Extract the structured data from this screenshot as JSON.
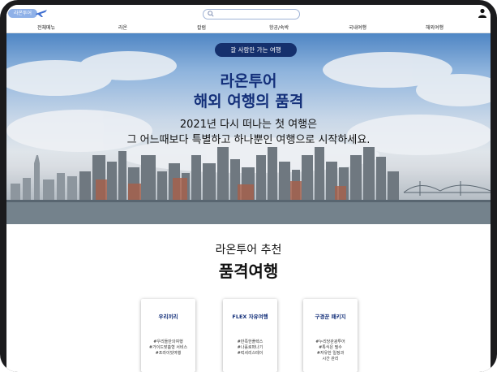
{
  "header": {
    "logo_text": "라온투어",
    "search": {
      "placeholder": ""
    }
  },
  "nav": {
    "items": [
      "전체메뉴",
      "라온",
      "칼럼",
      "항공/숙박",
      "국내여행",
      "해외여행"
    ]
  },
  "hero": {
    "pill": "갈 사람만 가는 여행",
    "title_line1": "라온투어",
    "title_line2": "해외 여행의 품격",
    "subtitle_line1": "2021년 다시 떠나는 첫 여행은",
    "subtitle_line2": "그 어느때보다 특별하고 하나뿐인 여행으로 시작하세요."
  },
  "recommend": {
    "subtitle": "라온투어 추천",
    "title": "품격여행",
    "cards": [
      {
        "title": "우리끼리",
        "tags": [
          "#우리들만의여행",
          "#가이드맞춤형 서비스",
          "#프라이빗여행"
        ]
      },
      {
        "title": "FLEX 자유여행",
        "tags": [
          "#만족한플렉스",
          "#나홀로떠나기",
          "#럭셔리스테이"
        ]
      },
      {
        "title": "구경꾼 패키지",
        "tags": [
          "#누리당관광투어",
          "#특식은 필수",
          "#자유한 일정과",
          "시간 관리"
        ]
      }
    ]
  },
  "colors": {
    "brand_navy": "#14307a",
    "pill_bg": "#15306d",
    "logo_blue": "#8fb1e8"
  },
  "icons": {
    "logo": "airplane-icon",
    "search": "search-icon",
    "user": "user-icon"
  }
}
